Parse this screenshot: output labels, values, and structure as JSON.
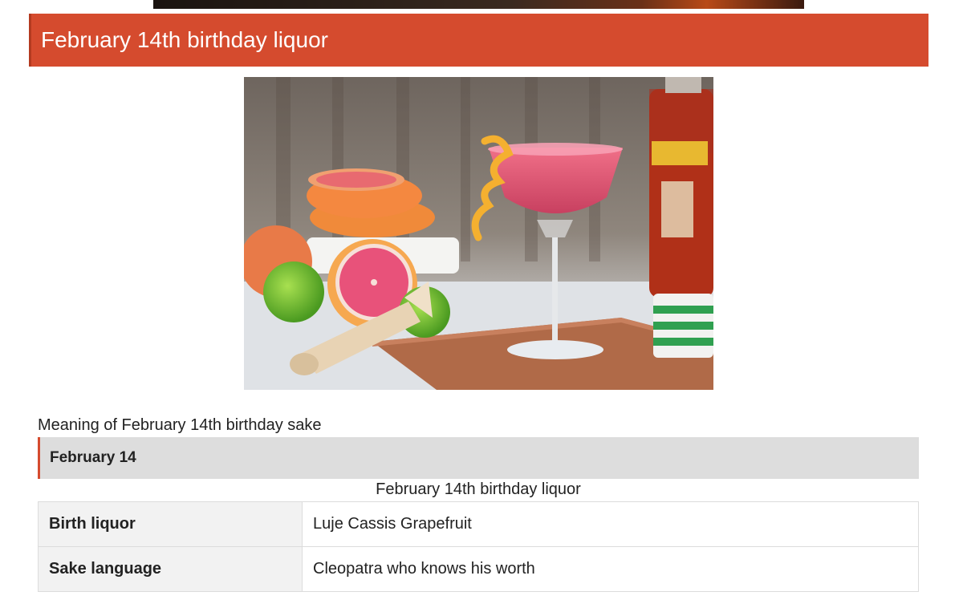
{
  "section": {
    "title": "February 14th birthday liquor"
  },
  "meaning_text": "Meaning of February 14th birthday sake",
  "subheader": "February 14",
  "table": {
    "caption": "February 14th birthday liquor",
    "rows": [
      {
        "key": "Birth liquor",
        "value": "Luje Cassis Grapefruit"
      },
      {
        "key": "Sake language",
        "value": "Cleopatra who knows his worth"
      }
    ]
  },
  "colors": {
    "header_bg": "#d54b2e",
    "subheader_bg": "#dddddd",
    "table_key_bg": "#f2f2f2"
  }
}
